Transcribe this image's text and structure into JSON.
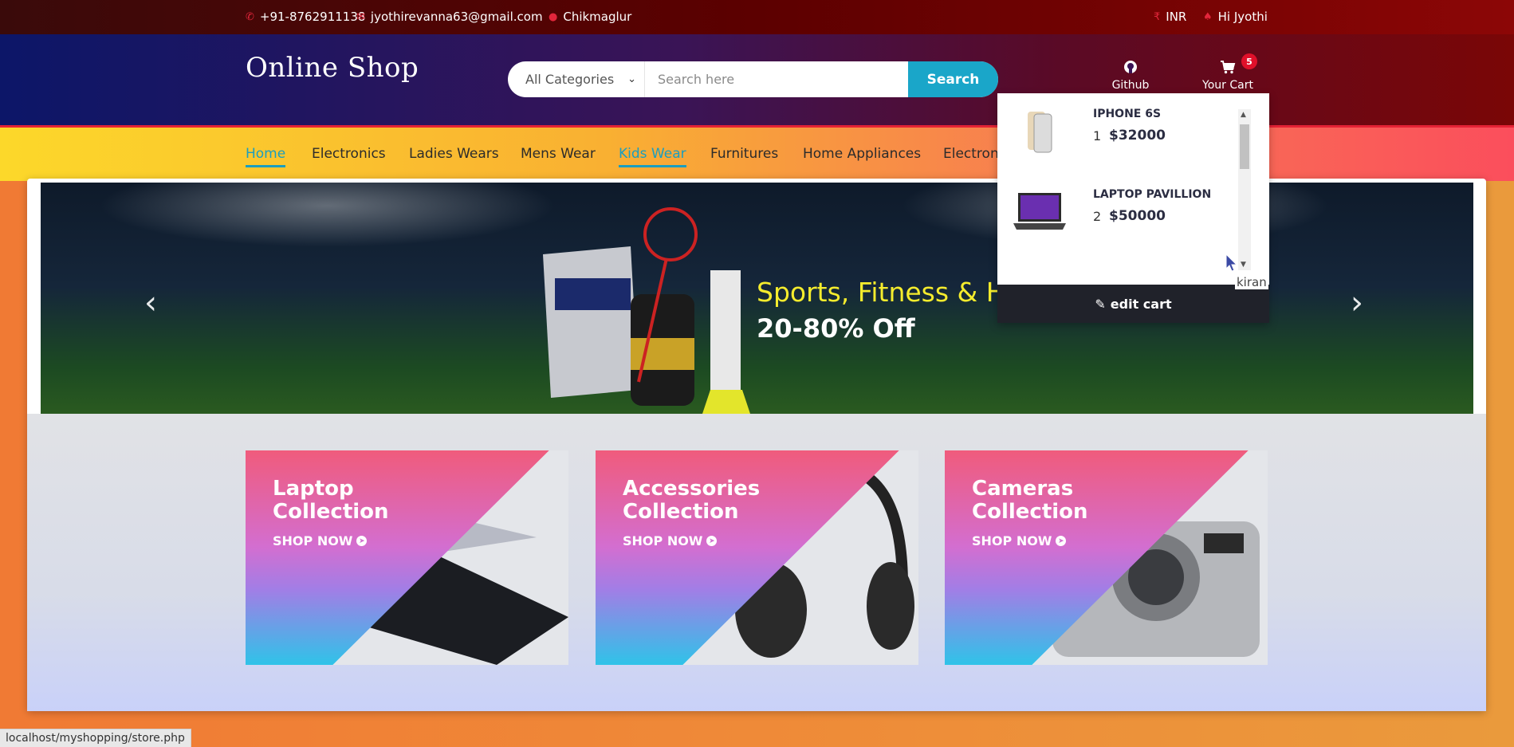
{
  "topbar": {
    "phone": "+91-8762911138",
    "email": "jyothirevanna63@gmail.com",
    "location": "Chikmaglur",
    "currency": "INR",
    "greeting": "Hi Jyothi"
  },
  "header": {
    "logo": "Online Shop",
    "category_selected": "All Categories",
    "search_placeholder": "Search here",
    "search_button": "Search",
    "github_label": "Github",
    "cart_label": "Your Cart",
    "cart_count": "5"
  },
  "nav": {
    "items": [
      "Home",
      "Electronics",
      "Ladies Wears",
      "Mens Wear",
      "Kids Wear",
      "Furnitures",
      "Home Appliances",
      "Electron"
    ]
  },
  "banner": {
    "headline": "Sports, Fitness & He",
    "subline": "20-80% Off"
  },
  "collections": [
    {
      "title_line1": "Laptop",
      "title_line2": "Collection",
      "cta": "SHOP NOW"
    },
    {
      "title_line1": "Accessories",
      "title_line2": "Collection",
      "cta": "SHOP NOW"
    },
    {
      "title_line1": "Cameras",
      "title_line2": "Collection",
      "cta": "SHOP NOW"
    }
  ],
  "cart": {
    "items": [
      {
        "name": "IPHONE 6S",
        "qty": "1",
        "price": "$32000"
      },
      {
        "name": "LAPTOP PAVILLION",
        "qty": "2",
        "price": "$50000"
      }
    ],
    "edit_label": "edit cart",
    "tooltip": "kiran"
  },
  "colors": {
    "accent": "#1aa6c9",
    "badge": "#e0102a",
    "topbar_icon": "#e3263b"
  },
  "status_url": "localhost/myshopping/store.php"
}
